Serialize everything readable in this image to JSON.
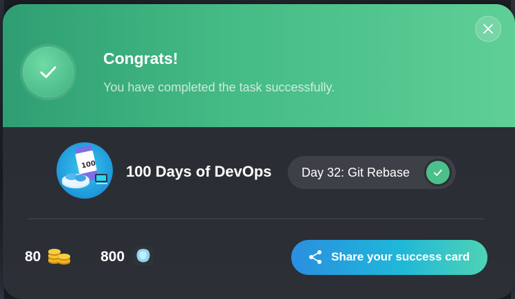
{
  "modal": {
    "title": "Congrats!",
    "message": "You have completed the task successfully.",
    "close_icon": "close-icon"
  },
  "course": {
    "name": "100 Days of DevOps",
    "avatar_text": "100",
    "current_day": "Day 32: Git Rebase",
    "day_status_icon": "check-icon"
  },
  "rewards": {
    "coins": "80",
    "gems": "800"
  },
  "share": {
    "label": "Share your success card",
    "icon": "share-icon"
  },
  "colors": {
    "header_start": "#2f9e73",
    "header_end": "#5fcf97",
    "body_bg": "#2b2e35",
    "pill_bg": "#3d4047",
    "check_green": "#4cc08a",
    "share_gradient_start": "#2a8fe0",
    "share_gradient_end": "#4fd3b5"
  }
}
